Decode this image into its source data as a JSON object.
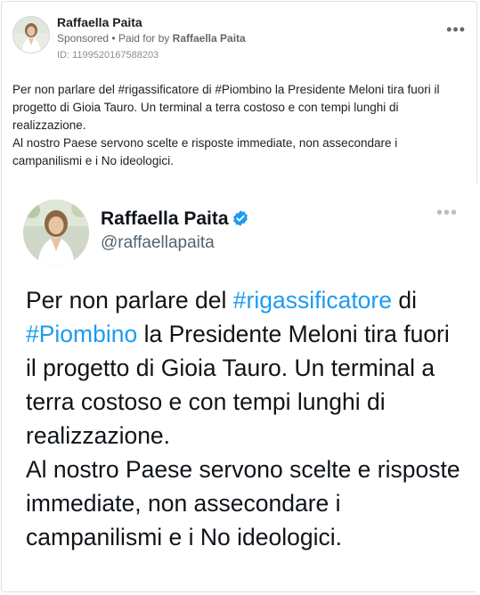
{
  "ad": {
    "author": "Raffaella Paita",
    "sponsored_label": "Sponsored",
    "paid_for_prefix": "Paid for by",
    "paid_for_name": "Raffaella Paita",
    "id_label": "ID: 1199520167588203",
    "more_icon": "ellipsis-icon",
    "caption_line1": "Per non parlare del #rigassificatore di #Piombino la Presidente Meloni tira fuori il progetto di Gioia Tauro. Un terminal a terra costoso e con tempi lunghi di realizzazione.",
    "caption_line2": "Al nostro Paese servono scelte e risposte immediate, non assecondare i campanilismi e i No ideologici."
  },
  "tweet": {
    "name": "Raffaella Paita",
    "handle": "@raffaellapaita",
    "verified_color": "#1d9bf0",
    "hashtag_color": "#1d9bf0",
    "text": {
      "part1": "Per non parlare del ",
      "hashtag1": "#rigassificatore",
      "part2": " di ",
      "hashtag2": "#Piombino",
      "part3": " la Presidente Meloni tira fuori il progetto di Gioia Tauro. Un terminal a terra costoso e con tempi lunghi di realizzazione.",
      "line2": "Al nostro Paese servono scelte e risposte immediate, non assecondare i campanilismi e i No ideologici."
    }
  }
}
